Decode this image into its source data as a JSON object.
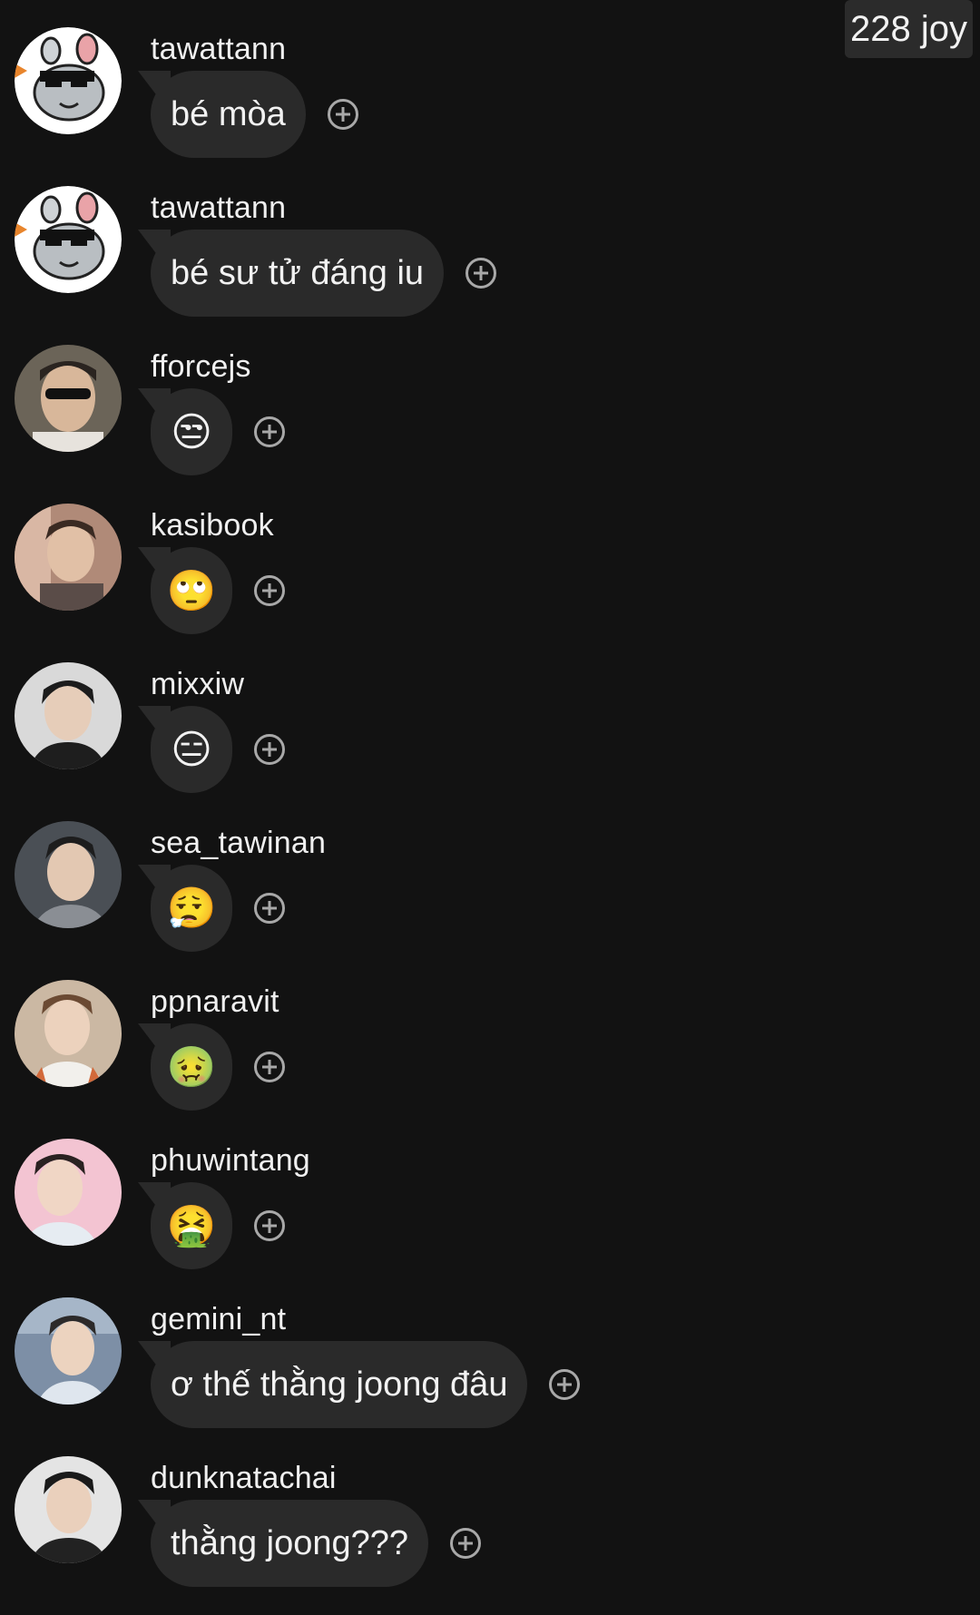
{
  "header": {
    "viewer_count": "228 joy"
  },
  "comments": [
    {
      "username": "tawattann",
      "text": "bé mòa",
      "type": "text",
      "avatar": "chinchilla-sunglasses-avatar"
    },
    {
      "username": "tawattann",
      "text": "bé sư tử đáng iu",
      "type": "text",
      "avatar": "chinchilla-sunglasses-avatar"
    },
    {
      "username": "fforcejs",
      "text": "😒",
      "type": "emoji",
      "avatar": "profile-photo"
    },
    {
      "username": "kasibook",
      "text": "🙄",
      "type": "emoji",
      "avatar": "profile-photo"
    },
    {
      "username": "mixxiw",
      "text": "😑",
      "type": "emoji",
      "avatar": "profile-photo"
    },
    {
      "username": "sea_tawinan",
      "text": "😮‍💨",
      "type": "emoji",
      "avatar": "profile-photo"
    },
    {
      "username": "ppnaravit",
      "text": "🤢",
      "type": "emoji",
      "avatar": "profile-photo"
    },
    {
      "username": "phuwintang",
      "text": "🤮",
      "type": "emoji",
      "avatar": "profile-photo"
    },
    {
      "username": "gemini_nt",
      "text": "ơ thế thằng joong đâu",
      "type": "text",
      "avatar": "profile-photo"
    },
    {
      "username": "dunknatachai",
      "text": "thằng joong???",
      "type": "text",
      "avatar": "profile-photo"
    }
  ],
  "colors": {
    "background": "#121212",
    "bubble": "#2a2a2a",
    "text": "#f2f2f2",
    "icon": "#a8a8a8"
  }
}
